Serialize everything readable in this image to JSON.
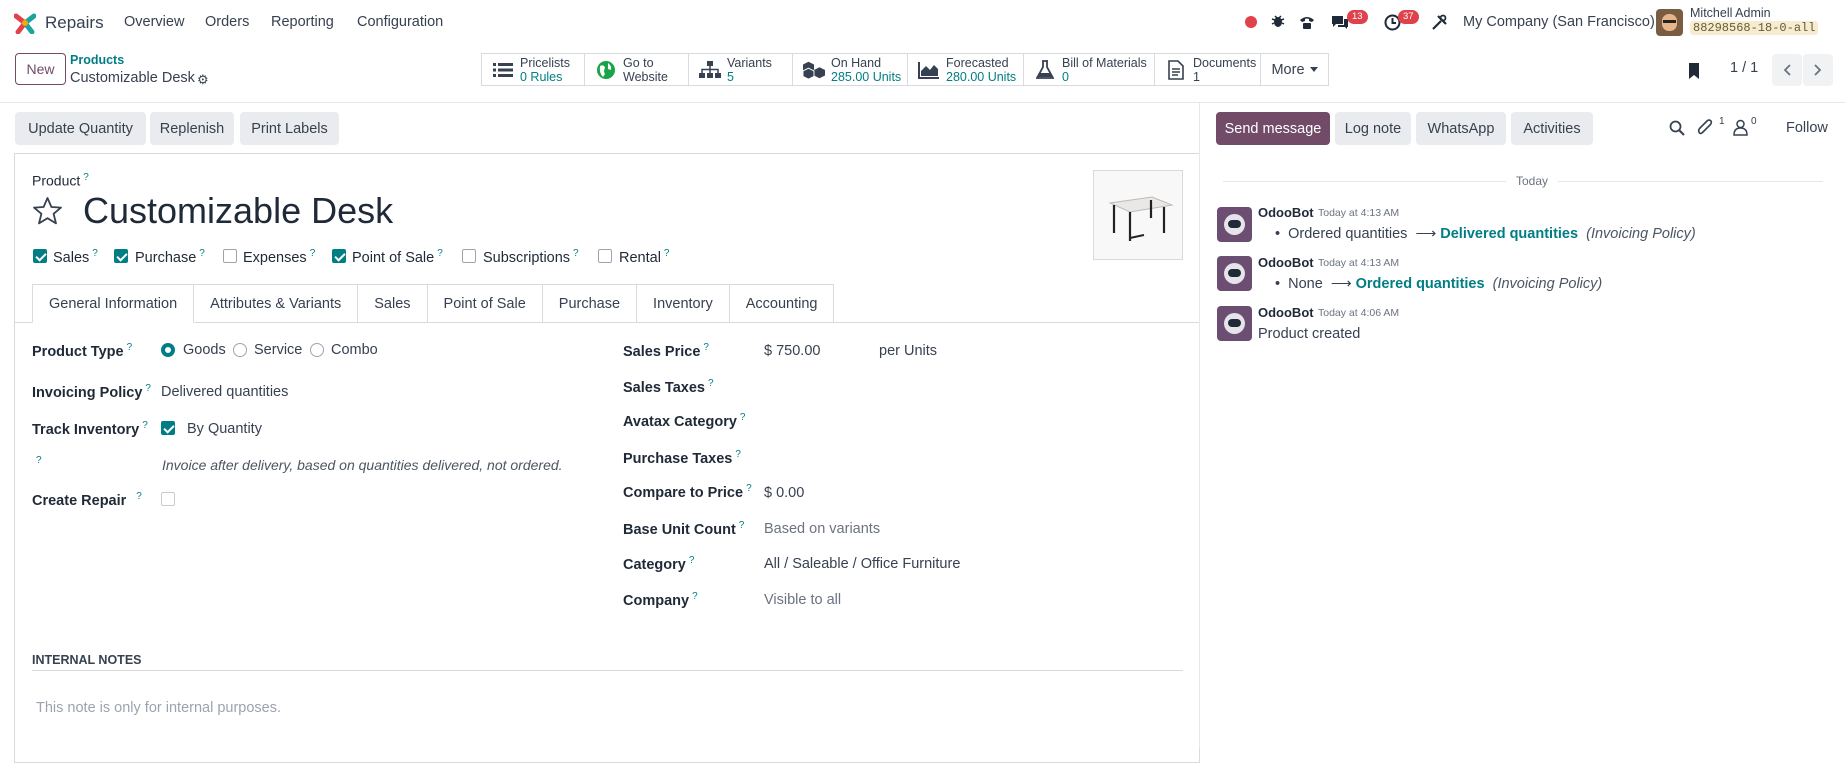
{
  "topbar": {
    "app_name": "Repairs",
    "menu": [
      "Overview",
      "Orders",
      "Reporting",
      "Configuration"
    ],
    "chat_count": "13",
    "activity_count": "37",
    "company": "My Company (San Francisco)",
    "user_name": "Mitchell Admin",
    "db_name": "88298568-18-0-all"
  },
  "control": {
    "new_label": "New",
    "breadcrumb_parent": "Products",
    "breadcrumb_current": "Customizable Desk",
    "smart_buttons": [
      {
        "title": "Pricelists",
        "value": "0 Rules",
        "icon": "list-icon"
      },
      {
        "title": "Go to",
        "value": "Website",
        "icon": "globe-icon"
      },
      {
        "title": "Variants",
        "value": "5",
        "icon": "sitemap-icon"
      },
      {
        "title": "On Hand",
        "value": "285.00 Units",
        "icon": "cubes-icon"
      },
      {
        "title": "Forecasted",
        "value": "280.00 Units",
        "icon": "area-chart-icon"
      },
      {
        "title": "Bill of Materials",
        "value": "0",
        "icon": "flask-icon"
      },
      {
        "title": "Documents",
        "value": "1",
        "icon": "document-icon"
      }
    ],
    "more_label": "More",
    "pager": "1 / 1"
  },
  "actions": {
    "update_quantity": "Update Quantity",
    "replenish": "Replenish",
    "print_labels": "Print Labels"
  },
  "form": {
    "product_label": "Product",
    "product_name": "Customizable Desk",
    "checkboxes": [
      {
        "label": "Sales",
        "checked": true
      },
      {
        "label": "Purchase",
        "checked": true
      },
      {
        "label": "Expenses",
        "checked": false
      },
      {
        "label": "Point of Sale",
        "checked": true
      },
      {
        "label": "Subscriptions",
        "checked": false
      },
      {
        "label": "Rental",
        "checked": false
      }
    ],
    "tabs": [
      "General Information",
      "Attributes & Variants",
      "Sales",
      "Point of Sale",
      "Purchase",
      "Inventory",
      "Accounting"
    ],
    "product_type_label": "Product Type",
    "product_types": [
      "Goods",
      "Service",
      "Combo"
    ],
    "product_type_selected": "Goods",
    "invoicing_policy_label": "Invoicing Policy",
    "invoicing_policy_value": "Delivered quantities",
    "track_inventory_label": "Track Inventory",
    "track_inventory_value": "By Quantity",
    "invoice_hint": "Invoice after delivery, based on quantities delivered, not ordered.",
    "create_repair_label": "Create Repair",
    "sales_price_label": "Sales Price",
    "sales_price_value": "$ 750.00",
    "sales_price_unit": "per Units",
    "sales_taxes_label": "Sales Taxes",
    "avatax_label": "Avatax Category",
    "purchase_taxes_label": "Purchase Taxes",
    "compare_price_label": "Compare to Price",
    "compare_price_value": "$ 0.00",
    "base_unit_label": "Base Unit Count",
    "base_unit_value": "Based on variants",
    "category_label": "Category",
    "category_value": "All / Saleable / Office Furniture",
    "company_label": "Company",
    "company_value": "Visible to all",
    "internal_notes_title": "INTERNAL NOTES",
    "internal_notes_placeholder": "This note is only for internal purposes."
  },
  "chatter": {
    "send_message": "Send message",
    "log_note": "Log note",
    "whatsapp": "WhatsApp",
    "activities": "Activities",
    "attachments_count": "1",
    "followers_count": "0",
    "follow": "Follow",
    "date_separator": "Today",
    "messages": [
      {
        "author": "OdooBot",
        "time": "Today at 4:13 AM",
        "old": "Ordered quantities",
        "new": "Delivered quantities",
        "field": "(Invoicing Policy)"
      },
      {
        "author": "OdooBot",
        "time": "Today at 4:13 AM",
        "old": "None",
        "new": "Ordered quantities",
        "field": "(Invoicing Policy)"
      },
      {
        "author": "OdooBot",
        "time": "Today at 4:06 AM",
        "body": "Product created"
      }
    ]
  },
  "colors": {
    "brand": "#714B67",
    "accent": "#017e84",
    "badge": "#e0424b"
  }
}
